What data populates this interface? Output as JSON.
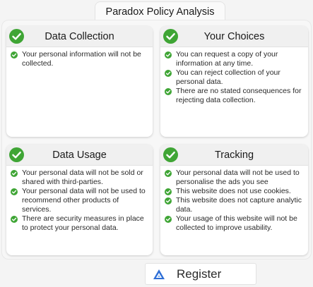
{
  "title": "Paradox Policy Analysis",
  "colors": {
    "check": "#3fa535",
    "register_icon": "#2f6fd6"
  },
  "cards": [
    {
      "title": "Data Collection",
      "icon": "check-circle-icon",
      "items": [
        "Your personal information will not be collected."
      ]
    },
    {
      "title": "Your Choices",
      "icon": "check-circle-icon",
      "items": [
        "You can request a copy of your information at any time.",
        "You can reject collection of your personal data.",
        "There are no stated consequences for rejecting data collection."
      ]
    },
    {
      "title": "Data Usage",
      "icon": "check-circle-icon",
      "items": [
        "Your personal data will not be sold or shared with third-parties.",
        "Your personal data will not be used to recommend other products of services.",
        "There are security measures in place to protect your personal data."
      ]
    },
    {
      "title": "Tracking",
      "icon": "check-circle-icon",
      "items": [
        "Your personal data will not be used to personalise the ads you see",
        "This website does not use cookies.",
        "This website does not capture analytic data.",
        "Your usage of this website will not be collected to improve usability."
      ]
    }
  ],
  "register": {
    "label": "Register",
    "icon": "triangle-logo-icon"
  }
}
